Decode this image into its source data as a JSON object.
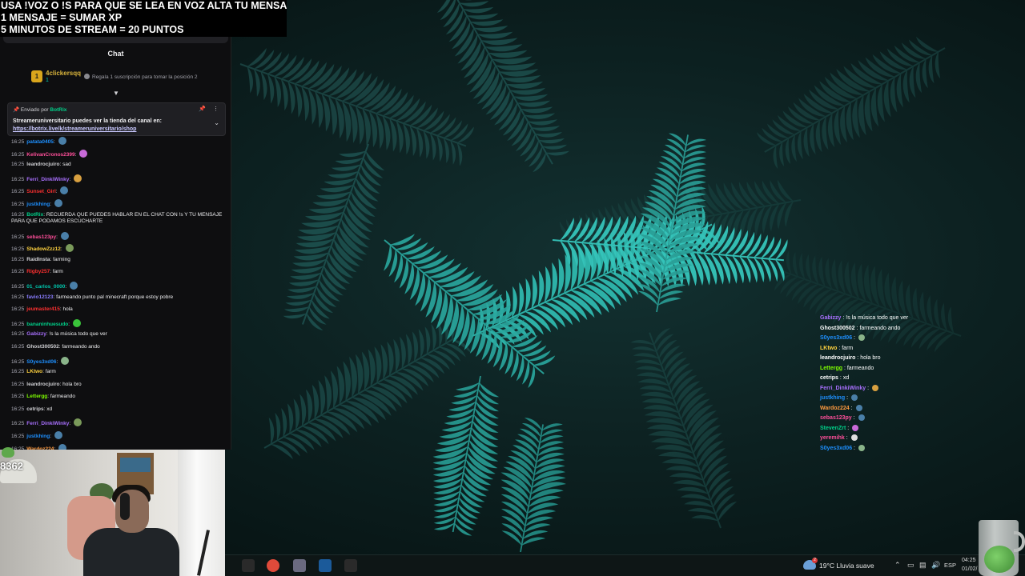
{
  "banner": {
    "lines": [
      "USA !VOZ O !S PARA QUE SE LEA EN VOZ ALTA TU MENSAJE",
      "1 MENSAJE = SUMAR XP",
      "5 MINUTOS DE STREAM = 20 PUNTOS"
    ]
  },
  "chat": {
    "title": "Chat",
    "leaderboard": {
      "rank": "1",
      "user": "4clickersqq",
      "count": "1",
      "gift_text": "Regala 1 suscripción para tomar la posición 2"
    },
    "pinned": {
      "sent_by": "Enviado por",
      "bot_name": "BotRix",
      "message": "Streameruniversitario puedes ver la tienda del canal en:",
      "link": "https://botrix.live/k/streameruniversitario/shop"
    },
    "messages": [
      {
        "time": "16:25",
        "user": "patata0405",
        "color": "#1e90ff",
        "text": "",
        "emote": "#4a7fa8"
      },
      {
        "time": "16:25",
        "user": "KelivanCronos2399",
        "color": "#ff4f9a",
        "text": "",
        "emote": "#c86ad8"
      },
      {
        "time": "16:25",
        "user": "leandrocjuiro",
        "color": "#d0d0d4",
        "text": "sad",
        "emote": ""
      },
      {
        "time": "16:25",
        "user": "Ferri_DinkiWinky",
        "color": "#a970ff",
        "text": "",
        "emote": "#d8a040"
      },
      {
        "time": "16:25",
        "user": "Sunset_Girl",
        "color": "#ff3030",
        "text": "",
        "emote": "#4a7fa8"
      },
      {
        "time": "16:25",
        "user": "justkhing",
        "color": "#1e90ff",
        "text": "",
        "emote": "#4a7fa8"
      },
      {
        "time": "16:25",
        "user": "BotRix",
        "color": "#00d18a",
        "text": "RECUERDA QUE PUEDES HABLAR EN EL CHAT CON !s Y TU MENSAJE PARA QUE PODAMOS ESCUCHARTE",
        "emote": ""
      },
      {
        "time": "16:25",
        "user": "sebas123py",
        "color": "#ff4f9a",
        "text": "",
        "emote": "#4a7fa8"
      },
      {
        "time": "16:25",
        "user": "ShadowZzz12",
        "color": "#ffd23f",
        "text": "",
        "emote": "#7a9a5a"
      },
      {
        "time": "16:25",
        "user": "RaidInsta",
        "color": "#d0d0d4",
        "text": "farming",
        "emote": ""
      },
      {
        "time": "16:25",
        "user": "Rigby257",
        "color": "#ff3030",
        "text": "farm",
        "emote": ""
      },
      {
        "time": "16:25",
        "user": "01_carlos_0000",
        "color": "#00c8af",
        "text": "",
        "emote": "#4a7fa8"
      },
      {
        "time": "16:25",
        "user": "favio12123",
        "color": "#8a7dff",
        "text": "farmeando punto pal minecraft porque estoy pobre",
        "emote": ""
      },
      {
        "time": "16:25",
        "user": "jeumaster415",
        "color": "#ff3030",
        "text": "hola",
        "emote": ""
      },
      {
        "time": "16:25",
        "user": "bananinhuesudo",
        "color": "#00d18a",
        "text": "",
        "emote": "#3ac43a"
      },
      {
        "time": "16:25",
        "user": "Gabizzy",
        "color": "#a970ff",
        "text": "!s la música todo que ver",
        "emote": ""
      },
      {
        "time": "16:25",
        "user": "Ghost300502",
        "color": "#d0d0d4",
        "text": "farmeando ando",
        "emote": ""
      },
      {
        "time": "16:25",
        "user": "S0yes3xd06",
        "color": "#1e90ff",
        "text": "",
        "emote": "#8ab48a"
      },
      {
        "time": "16:25",
        "user": "LKtwo",
        "color": "#ffd23f",
        "text": "farm",
        "emote": ""
      },
      {
        "time": "16:25",
        "user": "leandrocjuiro",
        "color": "#d0d0d4",
        "text": "hola bro",
        "emote": ""
      },
      {
        "time": "16:25",
        "user": "Lettergg",
        "color": "#7fff00",
        "text": "farmeando",
        "emote": ""
      },
      {
        "time": "16:25",
        "user": "cetrips",
        "color": "#d0d0d4",
        "text": "xd",
        "emote": ""
      },
      {
        "time": "16:25",
        "user": "Ferri_DinkiWinky",
        "color": "#a970ff",
        "text": "",
        "emote": "#7a9a5a"
      },
      {
        "time": "16:25",
        "user": "justkhing",
        "color": "#1e90ff",
        "text": "",
        "emote": "#4a7fa8"
      },
      {
        "time": "16:25",
        "user": "Wardoz224",
        "color": "#ff9a3f",
        "text": "",
        "emote": "#4a7fa8"
      }
    ]
  },
  "webcam": {
    "score": "8362"
  },
  "overlay_chat": {
    "messages": [
      {
        "user": "Gabizzy",
        "color": "#a970ff",
        "text": "!s la música todo que ver",
        "emote": ""
      },
      {
        "user": "Ghost300502",
        "color": "#ffffff",
        "text": "farmeando ando",
        "emote": ""
      },
      {
        "user": "S0yes3xd06",
        "color": "#1e90ff",
        "text": "",
        "emote": "#8ab48a"
      },
      {
        "user": "LKtwo",
        "color": "#ffd23f",
        "text": "farm",
        "emote": ""
      },
      {
        "user": "leandrocjuiro",
        "color": "#ffffff",
        "text": "hola bro",
        "emote": ""
      },
      {
        "user": "Lettergg",
        "color": "#7fff00",
        "text": "farmeando",
        "emote": ""
      },
      {
        "user": "cetrips",
        "color": "#ffffff",
        "text": "xd",
        "emote": ""
      },
      {
        "user": "Ferri_DinkiWinky",
        "color": "#a970ff",
        "text": "",
        "emote": "#d8a040"
      },
      {
        "user": "justkhing",
        "color": "#1e90ff",
        "text": "",
        "emote": "#4a7fa8"
      },
      {
        "user": "Wardoz224",
        "color": "#ff9a3f",
        "text": "",
        "emote": "#4a7fa8"
      },
      {
        "user": "sebas123py",
        "color": "#ff4f9a",
        "text": "",
        "emote": "#4a7fa8"
      },
      {
        "user": "StevenZrt",
        "color": "#00d18a",
        "text": "",
        "emote": "#c86ad8"
      },
      {
        "user": "yeremihk",
        "color": "#ff4f9a",
        "text": "",
        "emote": "#e0e0e0"
      },
      {
        "user": "S0yes3xd06",
        "color": "#1e90ff",
        "text": "",
        "emote": "#8ab48a"
      }
    ]
  },
  "taskbar": {
    "apps": [
      {
        "name": "lucid-icon",
        "color": "#2a2a2a"
      },
      {
        "name": "chrome-icon",
        "color": "#e04a3a"
      },
      {
        "name": "app-icon",
        "color": "#6a6a80"
      },
      {
        "name": "steam-icon",
        "color": "#1b5a9a"
      },
      {
        "name": "epic-icon",
        "color": "#2a2a2a"
      }
    ],
    "weather_badge": "2",
    "weather": "19°C  Lluvia suave",
    "language": "ESP",
    "time": "04:25",
    "date": "01/02/"
  }
}
